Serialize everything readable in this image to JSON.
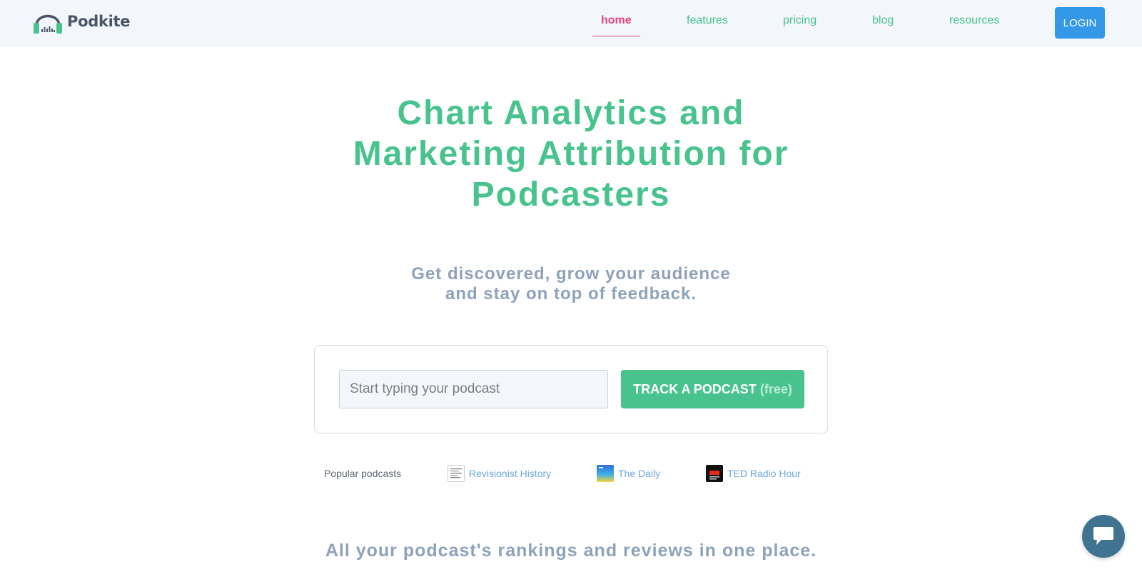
{
  "brand": {
    "name": "Podkite"
  },
  "nav": {
    "items": [
      {
        "label": "home",
        "active": true
      },
      {
        "label": "features",
        "active": false
      },
      {
        "label": "pricing",
        "active": false
      },
      {
        "label": "blog",
        "active": false
      },
      {
        "label": "resources",
        "active": false
      }
    ],
    "login_label": "LOGIN"
  },
  "hero": {
    "title_lines": [
      "Chart Analytics and",
      "Marketing Attribution for",
      "Podcasters"
    ],
    "subtitle_lines": [
      "Get discovered, grow your audience",
      "and stay on top of feedback."
    ]
  },
  "search": {
    "placeholder": "Start typing your podcast",
    "value": "",
    "button_label": "TRACK A PODCAST",
    "button_suffix": "(free)"
  },
  "popular": {
    "label": "Popular podcasts",
    "items": [
      {
        "name": "Revisionist History",
        "thumb_icon": "revisionist-history-cover-icon"
      },
      {
        "name": "The Daily",
        "thumb_icon": "the-daily-cover-icon"
      },
      {
        "name": "TED Radio Hour",
        "thumb_icon": "ted-radio-hour-cover-icon"
      }
    ]
  },
  "section": {
    "heading": "All your podcast's rankings and reviews in one place."
  },
  "colors": {
    "accent_green": "#48c38d",
    "active_pink": "#e8437b",
    "login_blue": "#3398e8",
    "muted_slate": "#8da2bb",
    "link_blue": "#6ea7d8",
    "chat_teal": "#3f7391"
  },
  "icons": {
    "logo": "headphones-logo-icon",
    "chat": "chat-bubble-icon"
  }
}
